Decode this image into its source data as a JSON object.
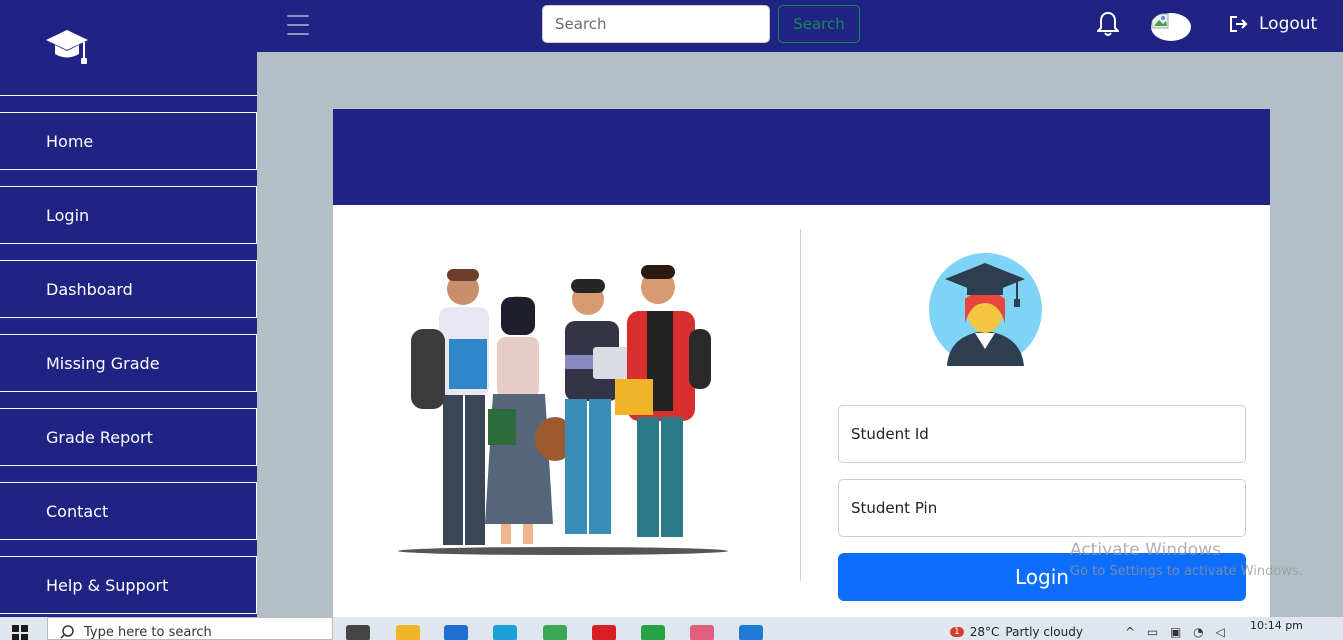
{
  "sidebar": {
    "items": [
      {
        "label": "Home"
      },
      {
        "label": "Login"
      },
      {
        "label": "Dashboard"
      },
      {
        "label": "Missing Grade"
      },
      {
        "label": "Grade Report"
      },
      {
        "label": "Contact"
      },
      {
        "label": "Help & Support"
      }
    ]
  },
  "topbar": {
    "search_placeholder": "Search",
    "search_button": "Search",
    "logout_label": "Logout"
  },
  "login_form": {
    "student_id_placeholder": "Student Id",
    "student_pin_placeholder": "Student Pin",
    "login_button": "Login"
  },
  "watermark": {
    "title": "Activate Windows",
    "subtitle": "Go to Settings to activate Windows."
  },
  "taskbar": {
    "search_placeholder": "Type here to search",
    "weather_temp": "28°C",
    "weather_desc": "Partly cloudy",
    "weather_badge": "1",
    "time": "10:14 pm"
  },
  "colors": {
    "navy": "#1f2484",
    "primary": "#0d6efd",
    "success": "#198754",
    "page_bg": "#b3bfc7"
  },
  "icons": [
    "graduation-cap-icon",
    "hamburger-icon",
    "bell-icon",
    "avatar",
    "logout-icon",
    "windows-icon",
    "search-icon"
  ]
}
